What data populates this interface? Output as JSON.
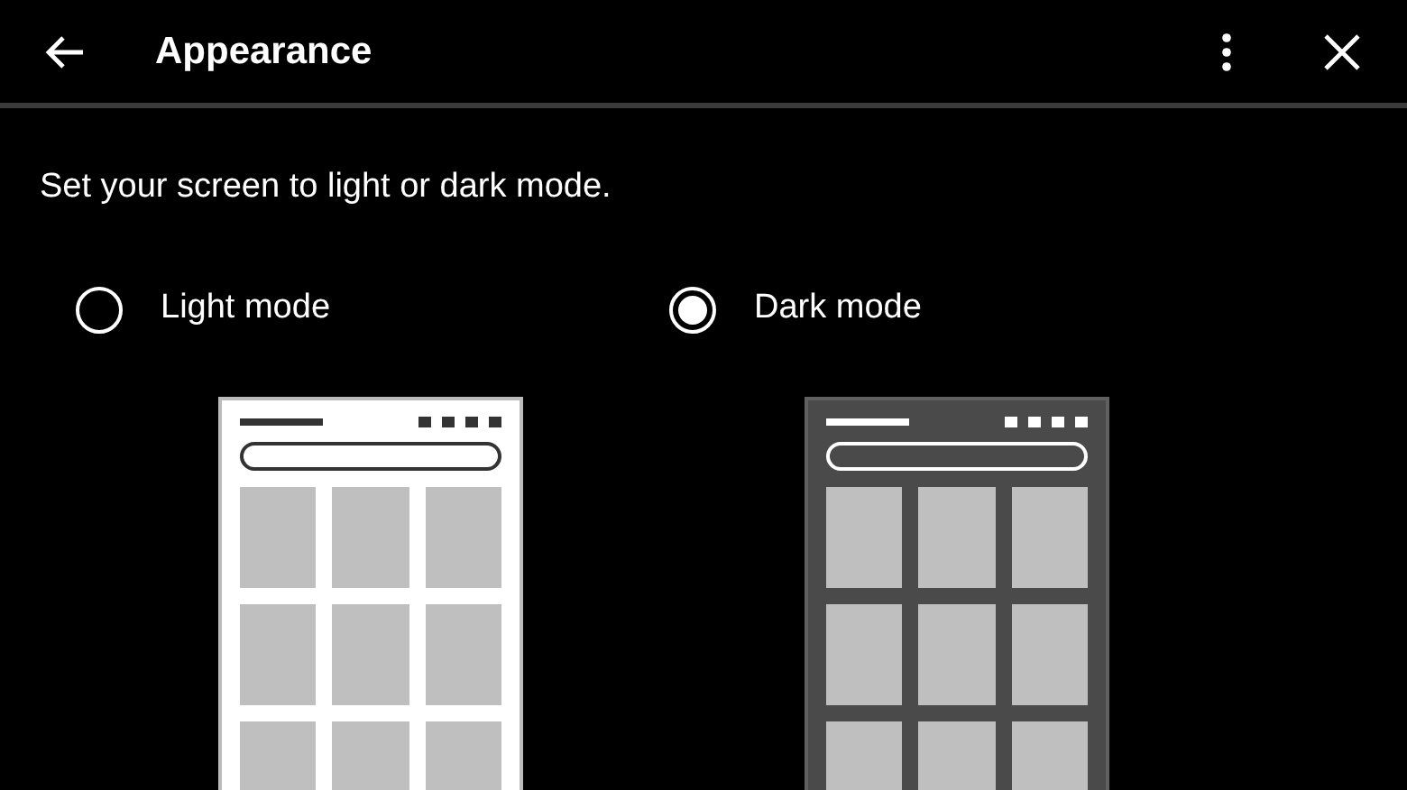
{
  "header": {
    "title": "Appearance"
  },
  "description": "Set your screen to light or dark mode.",
  "options": [
    {
      "label": "Light mode",
      "kind": "light",
      "selected": false
    },
    {
      "label": "Dark mode",
      "kind": "dark",
      "selected": true
    }
  ]
}
